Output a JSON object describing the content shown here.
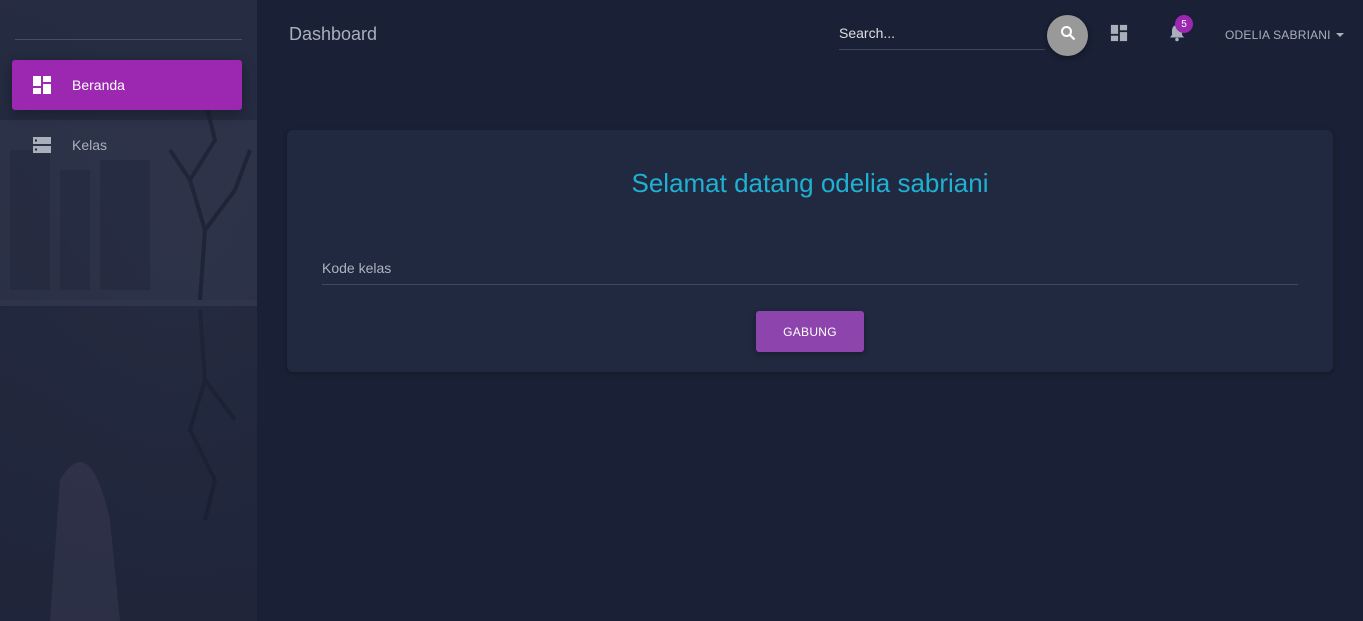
{
  "sidebar": {
    "items": [
      {
        "label": "Beranda",
        "icon": "dashboard-icon",
        "active": true
      },
      {
        "label": "Kelas",
        "icon": "storage-icon",
        "active": false
      }
    ]
  },
  "header": {
    "title": "Dashboard",
    "search": {
      "placeholder": "Search...",
      "value": ""
    },
    "notifications": {
      "count": "5"
    },
    "user": {
      "name": "ODELIA SABRIANI"
    }
  },
  "main": {
    "welcome": "Selamat datang odelia sabriani",
    "class_code": {
      "placeholder": "Kode kelas",
      "value": ""
    },
    "join_label": "GABUNG"
  },
  "colors": {
    "accent": "#9c27b0",
    "button": "#8e44ad",
    "welcome_text": "#1fb0d2",
    "background": "#1a2035",
    "card": "#202940"
  }
}
